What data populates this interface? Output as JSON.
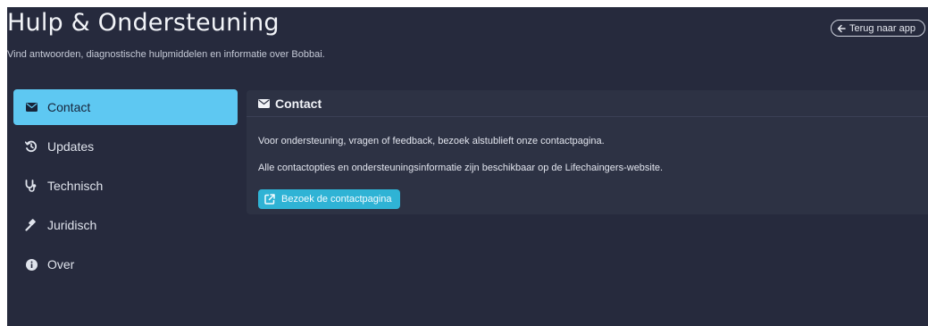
{
  "header": {
    "title": "Hulp & Ondersteuning",
    "subtitle": "Vind antwoorden, diagnostische hulpmiddelen en informatie over Bobbai.",
    "back_label": "Terug naar app"
  },
  "sidebar": {
    "items": [
      {
        "label": "Contact",
        "icon": "envelope-icon",
        "active": true
      },
      {
        "label": "Updates",
        "icon": "history-icon",
        "active": false
      },
      {
        "label": "Technisch",
        "icon": "stethoscope-icon",
        "active": false
      },
      {
        "label": "Juridisch",
        "icon": "gavel-icon",
        "active": false
      },
      {
        "label": "Over",
        "icon": "info-circle-icon",
        "active": false
      }
    ]
  },
  "panel": {
    "title": "Contact",
    "icon": "envelope-icon",
    "paragraphs": [
      "Voor ondersteuning, vragen of feedback, bezoek alstublieft onze contactpagina.",
      "Alle contactopties en ondersteuningsinformatie zijn beschikbaar op de Lifechaingers-website."
    ],
    "button_label": "Bezoek de contactpagina",
    "button_icon": "external-link-icon"
  },
  "colors": {
    "background": "#262a3d",
    "panel": "#2d3244",
    "accent_active": "#5ec8f2",
    "button": "#2fb3d5"
  }
}
